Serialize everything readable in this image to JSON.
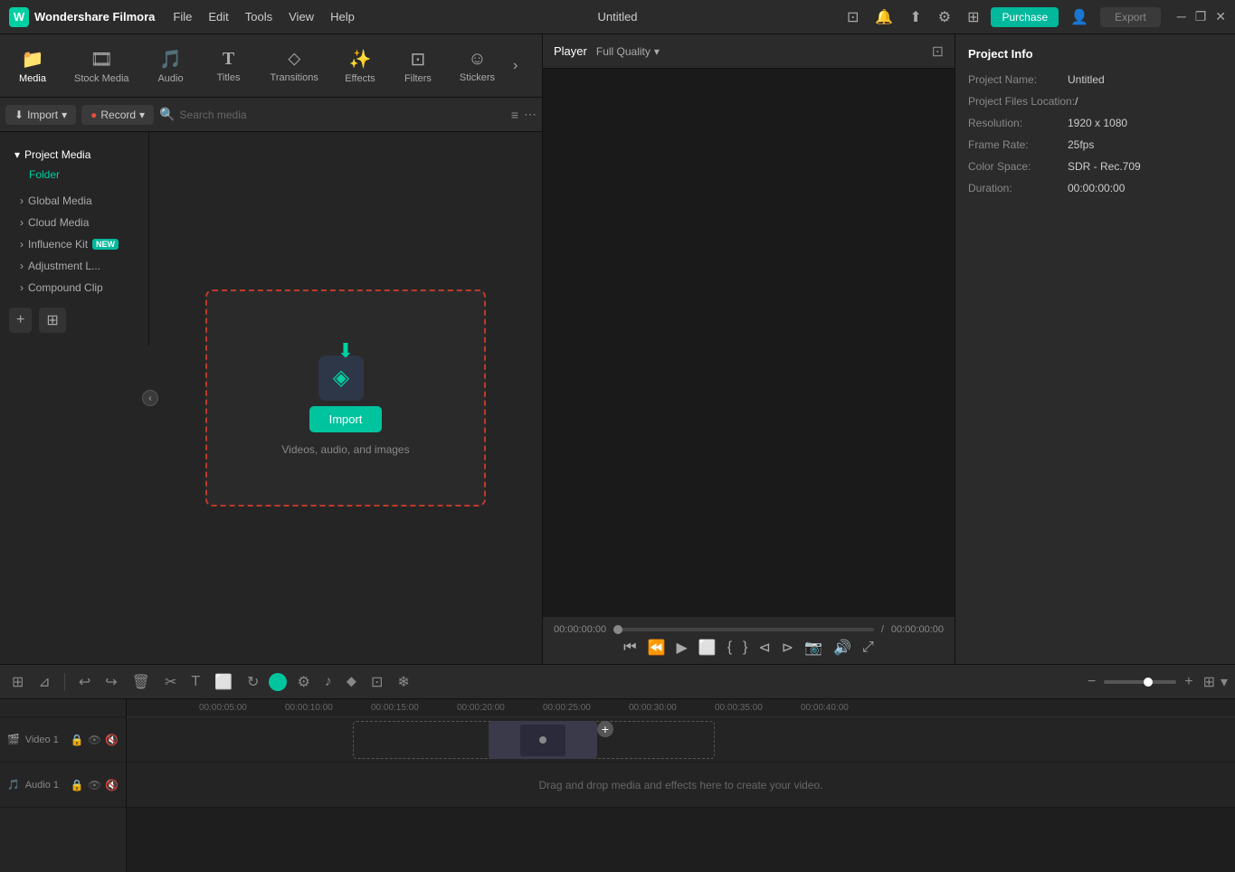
{
  "app": {
    "name": "Wondershare Filmora",
    "title": "Untitled"
  },
  "titlebar": {
    "menu": [
      "File",
      "Edit",
      "Tools",
      "View",
      "Help"
    ],
    "purchase_label": "Purchase",
    "export_label": "Export",
    "icons": [
      "minimize",
      "maximize",
      "close",
      "community",
      "upload",
      "settings",
      "grid"
    ]
  },
  "toolbar": {
    "tabs": [
      {
        "id": "media",
        "label": "Media",
        "icon": "🎬",
        "active": true
      },
      {
        "id": "stock-media",
        "label": "Stock Media",
        "icon": "🎞"
      },
      {
        "id": "audio",
        "label": "Audio",
        "icon": "🎵"
      },
      {
        "id": "titles",
        "label": "Titles",
        "icon": "T"
      },
      {
        "id": "transitions",
        "label": "Transitions",
        "icon": "⬧"
      },
      {
        "id": "effects",
        "label": "Effects",
        "icon": "✨"
      },
      {
        "id": "filters",
        "label": "Filters",
        "icon": "⊡"
      },
      {
        "id": "stickers",
        "label": "Stickers",
        "icon": "☺"
      }
    ]
  },
  "media_toolbar": {
    "import_label": "Import",
    "record_label": "Record",
    "search_placeholder": "Search media"
  },
  "sidebar": {
    "project_media": "Project Media",
    "folder_label": "Folder",
    "items": [
      {
        "id": "global-media",
        "label": "Global Media"
      },
      {
        "id": "cloud-media",
        "label": "Cloud Media"
      },
      {
        "id": "influence-kit",
        "label": "Influence Kit",
        "badge": "NEW"
      },
      {
        "id": "adjustment-l",
        "label": "Adjustment L..."
      },
      {
        "id": "compound-clip",
        "label": "Compound Clip"
      }
    ]
  },
  "content": {
    "import_btn": "Import",
    "import_hint": "Videos, audio, and images"
  },
  "player": {
    "tab": "Player",
    "quality": "Full Quality",
    "time_current": "00:00:00:00",
    "time_total": "00:00:00:00"
  },
  "project_info": {
    "title": "Project Info",
    "fields": [
      {
        "label": "Project Name:",
        "value": "Untitled"
      },
      {
        "label": "Project Files Location:",
        "value": "/"
      },
      {
        "label": "Resolution:",
        "value": "1920 x 1080"
      },
      {
        "label": "Frame Rate:",
        "value": "25fps"
      },
      {
        "label": "Color Space:",
        "value": "SDR - Rec.709"
      },
      {
        "label": "Duration:",
        "value": "00:00:00:00"
      }
    ]
  },
  "timeline": {
    "ruler_marks": [
      "00:00:05:00",
      "00:00:10:00",
      "00:00:15:00",
      "00:00:20:00",
      "00:00:25:00",
      "00:00:30:00",
      "00:00:35:00",
      "00:00:40:00"
    ],
    "video_track": "Video 1",
    "audio_track": "Audio 1",
    "drop_hint": "Drag and drop media and effects here to create your video."
  }
}
